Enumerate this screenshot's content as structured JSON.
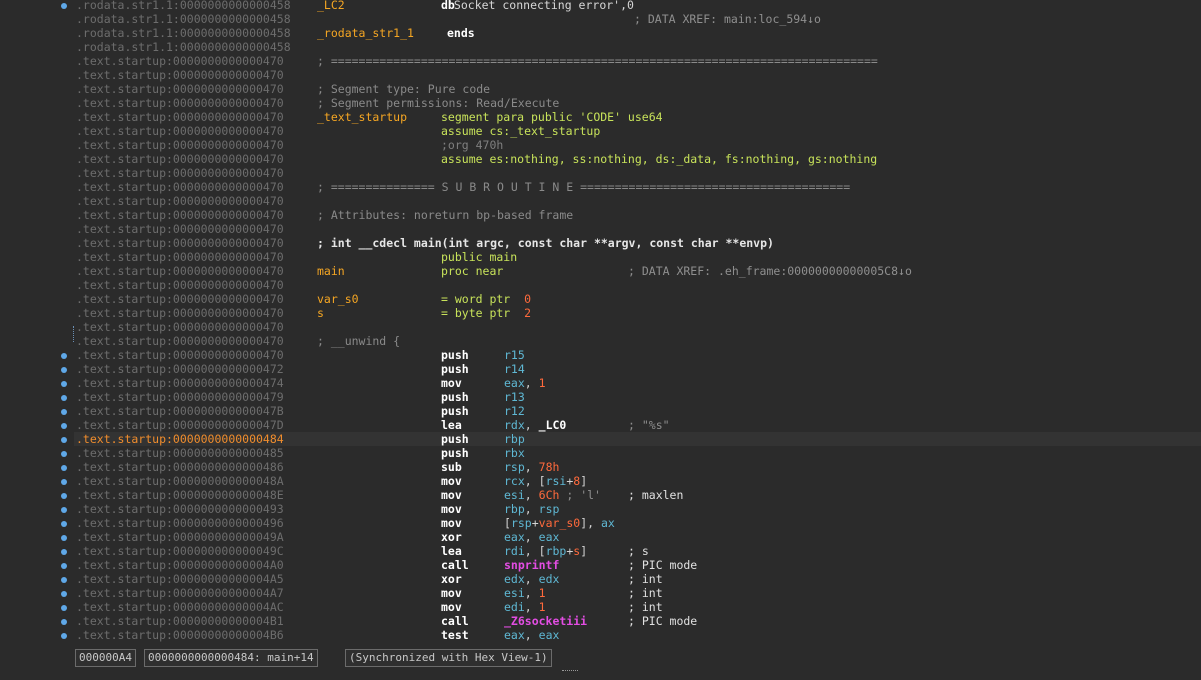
{
  "listing": {
    "lines": [
      {
        "addr": ".rodata.str1.1:0000000000000458",
        "sym": "_LC2",
        "mn": "db",
        "opHtml": "<span class='str'>'Socket connecting error'</span>,0",
        "opLeft": 373
      },
      {
        "addr": ".rodata.str1.1:0000000000000458",
        "cmHtml": "; DATA XREF: main:loc_594↓o",
        "cmLeft": 560
      },
      {
        "addr": ".rodata.str1.1:0000000000000458",
        "sym": "_rodata_str1_1",
        "symClass": "sym",
        "mn": "ends",
        "mnLeft": 373
      },
      {
        "addr": ".rodata.str1.1:0000000000000458"
      },
      {
        "addr": ".text.startup:0000000000000470",
        "c1": "; ==============================================================================="
      },
      {
        "addr": ".text.startup:0000000000000470"
      },
      {
        "addr": ".text.startup:0000000000000470",
        "c1": "; Segment type: Pure code"
      },
      {
        "addr": ".text.startup:0000000000000470",
        "c1": "; Segment permissions: Read/Execute"
      },
      {
        "addr": ".text.startup:0000000000000470",
        "sym": "_text_startup",
        "mn": "segment para public 'CODE' use64",
        "mnClass": "dir"
      },
      {
        "addr": ".text.startup:0000000000000470",
        "mn": "assume cs:_text_startup",
        "mnClass": "dir"
      },
      {
        "addr": ".text.startup:0000000000000470",
        "mn": ";org 470h",
        "mnClass": "cmt"
      },
      {
        "addr": ".text.startup:0000000000000470",
        "mn": "assume es:nothing, ss:nothing, ds:_data, fs:nothing, gs:nothing",
        "mnClass": "dir"
      },
      {
        "addr": ".text.startup:0000000000000470"
      },
      {
        "addr": ".text.startup:0000000000000470",
        "c1": "; =============== S U B R O U T I N E ======================================="
      },
      {
        "addr": ".text.startup:0000000000000470"
      },
      {
        "addr": ".text.startup:0000000000000470",
        "c1": "; Attributes: noreturn bp-based frame"
      },
      {
        "addr": ".text.startup:0000000000000470"
      },
      {
        "addr": ".text.startup:0000000000000470",
        "c1": "; int __cdecl main(int argc, const char **argv, const char **envp)",
        "c1Class": "hdr"
      },
      {
        "addr": ".text.startup:0000000000000470",
        "mn": "public main",
        "mnClass": "dir"
      },
      {
        "addr": ".text.startup:0000000000000470",
        "sym": "main",
        "mn": "proc near",
        "mnClass": "dir",
        "cmHtml": "; DATA XREF: .eh_frame:00000000000005C8↓o",
        "cmLeft": 554
      },
      {
        "addr": ".text.startup:0000000000000470"
      },
      {
        "addr": ".text.startup:0000000000000470",
        "sym": "var_s0",
        "symClass": "sym",
        "mn": "= word ptr  0",
        "mnClass": "dir",
        "numTail": true
      },
      {
        "addr": ".text.startup:0000000000000470",
        "sym": "s",
        "mn": "= byte ptr  2",
        "mnClass": "dir",
        "numTail": true
      },
      {
        "addr": ".text.startup:0000000000000470"
      },
      {
        "addr": ".text.startup:0000000000000470",
        "c1": "; __unwind {"
      },
      {
        "addr": ".text.startup:0000000000000470",
        "mn": "push",
        "opHtml": "<span class='reg'>r15</span>"
      },
      {
        "addr": ".text.startup:0000000000000472",
        "mn": "push",
        "opHtml": "<span class='reg'>r14</span>"
      },
      {
        "addr": ".text.startup:0000000000000474",
        "mn": "mov",
        "opHtml": "<span class='reg'>eax</span>, <span class='num'>1</span>"
      },
      {
        "addr": ".text.startup:0000000000000479",
        "mn": "push",
        "opHtml": "<span class='reg'>r13</span>"
      },
      {
        "addr": ".text.startup:000000000000047B",
        "mn": "push",
        "opHtml": "<span class='reg'>r12</span>"
      },
      {
        "addr": ".text.startup:000000000000047D",
        "mn": "lea",
        "opHtml": "<span class='reg'>rdx</span>, <span class='lbl'>_LC0</span>",
        "cmHtml": "; \"%s\"",
        "cmLeft": 554
      },
      {
        "addr": ".text.startup:0000000000000484",
        "mn": "push",
        "opHtml": "<span class='reg'>rbp</span>",
        "cur": true
      },
      {
        "addr": ".text.startup:0000000000000485",
        "mn": "push",
        "opHtml": "<span class='reg'>rbx</span>"
      },
      {
        "addr": ".text.startup:0000000000000486",
        "mn": "sub",
        "opHtml": "<span class='reg'>rsp</span>, <span class='num'>78h</span>"
      },
      {
        "addr": ".text.startup:000000000000048A",
        "mn": "mov",
        "opHtml": "<span class='reg'>rcx</span>, [<span class='reg'>rsi</span>+<span class='num'>8</span>]"
      },
      {
        "addr": ".text.startup:000000000000048E",
        "mn": "mov",
        "opHtml": "<span class='reg'>esi</span>, <span class='num'>6Ch</span> <span class='gray'>; 'l'</span>",
        "cmHtml": "<span class='cm b'>; maxlen</span>",
        "cmLeft": 554
      },
      {
        "addr": ".text.startup:0000000000000493",
        "mn": "mov",
        "opHtml": "<span class='reg'>rbp</span>, <span class='reg'>rsp</span>"
      },
      {
        "addr": ".text.startup:0000000000000496",
        "mn": "mov",
        "opHtml": "[<span class='reg'>rsp</span>+<span class='num'>var_s0</span>], <span class='reg'>ax</span>"
      },
      {
        "addr": ".text.startup:000000000000049A",
        "mn": "xor",
        "opHtml": "<span class='reg'>eax</span>, <span class='reg'>eax</span>"
      },
      {
        "addr": ".text.startup:000000000000049C",
        "mn": "lea",
        "opHtml": "<span class='reg'>rdi</span>, [<span class='reg'>rbp</span>+<span class='num'>s</span>]",
        "cmHtml": "<span class='cm b'>; s</span>",
        "cmLeft": 554
      },
      {
        "addr": ".text.startup:00000000000004A0",
        "mn": "call",
        "opHtml": "<span class='fn'>snprintf</span>",
        "cmHtml": "<span class='cm b'>; PIC mode</span>",
        "cmLeft": 554
      },
      {
        "addr": ".text.startup:00000000000004A5",
        "mn": "xor",
        "opHtml": "<span class='reg'>edx</span>, <span class='reg'>edx</span>",
        "cmHtml": "<span class='cm b'>; int</span>",
        "cmLeft": 554
      },
      {
        "addr": ".text.startup:00000000000004A7",
        "mn": "mov",
        "opHtml": "<span class='reg'>esi</span>, <span class='num'>1</span>",
        "cmHtml": "<span class='cm b'>; int</span>",
        "cmLeft": 554
      },
      {
        "addr": ".text.startup:00000000000004AC",
        "mn": "mov",
        "opHtml": "<span class='reg'>edi</span>, <span class='num'>1</span>",
        "cmHtml": "<span class='cm b'>; int</span>",
        "cmLeft": 554
      },
      {
        "addr": ".text.startup:00000000000004B1",
        "mn": "call",
        "opHtml": "<span class='fn'>_Z6socketiii</span>",
        "cmHtml": "<span class='cm b'>; PIC mode</span>",
        "cmLeft": 554
      },
      {
        "addr": ".text.startup:00000000000004B6",
        "mn": "test",
        "opHtml": "<span class='reg'>eax</span>, <span class='reg'>eax</span>"
      }
    ]
  },
  "status": {
    "offset": "000000A4",
    "location": "0000000000000484: main+14",
    "sync": "(Synchronized with Hex View-1)"
  },
  "colors": {
    "background": "#2b2b2b",
    "address": "#6d6d6d",
    "current_address": "#f08d2d",
    "symbol": "#f5a623",
    "register": "#5fb8d4",
    "number": "#ff6a3c",
    "function": "#e34de3",
    "directive": "#c8e35a"
  }
}
